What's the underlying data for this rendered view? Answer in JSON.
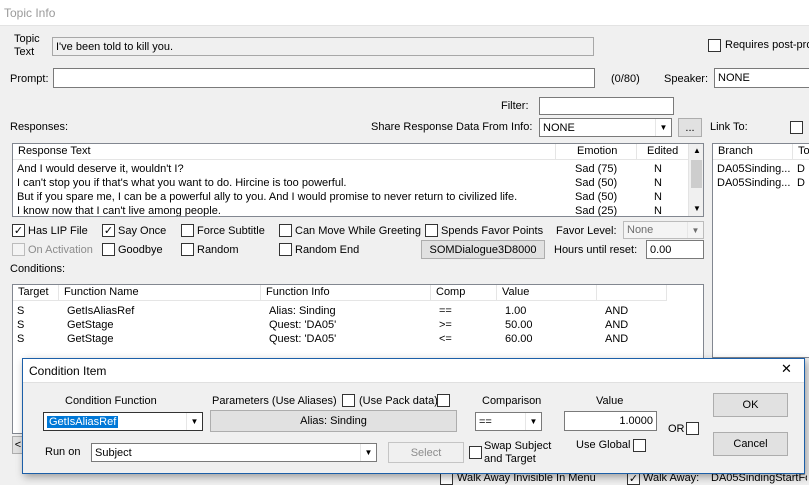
{
  "window": {
    "title": "Topic Info"
  },
  "topic": {
    "label": "Topic Text",
    "value": "I've been told to kill you."
  },
  "requires": {
    "label": "Requires post-pro"
  },
  "prompt": {
    "label": "Prompt:",
    "value": "",
    "counter": "(0/80)"
  },
  "speaker": {
    "label": "Speaker:",
    "value": "NONE"
  },
  "filter": {
    "label": "Filter:",
    "value": ""
  },
  "responses": {
    "label": "Responses:",
    "share_label": "Share Response Data From Info:",
    "share_value": "NONE",
    "ellipsis": "...",
    "columns": [
      "Response Text",
      "Emotion",
      "Edited"
    ],
    "rows": [
      {
        "text": "And I would deserve it, wouldn't I?",
        "emotion": "Sad (75)",
        "edited": "N"
      },
      {
        "text": "I can't stop you if that's what you want to do. Hircine is too powerful.",
        "emotion": "Sad (50)",
        "edited": "N"
      },
      {
        "text": "But if you spare me, I can be a powerful ally to you. And I would promise to never return to civilized life.",
        "emotion": "Sad (50)",
        "edited": "N"
      },
      {
        "text": "I know now that I can't live among people.",
        "emotion": "Sad (25)",
        "edited": "N"
      }
    ]
  },
  "link_to": {
    "label": "Link To:",
    "columns": [
      "Branch",
      "To"
    ],
    "rows": [
      {
        "branch": "DA05Sinding...",
        "to": "D"
      },
      {
        "branch": "DA05Sinding...",
        "to": "D"
      }
    ]
  },
  "flags": {
    "has_lip": {
      "label": "Has LIP File",
      "checked": true
    },
    "say_once": {
      "label": "Say Once",
      "checked": true
    },
    "force_subtitle": {
      "label": "Force Subtitle",
      "checked": false
    },
    "can_move": {
      "label": "Can Move While Greeting",
      "checked": false
    },
    "spends_favor": {
      "label": "Spends Favor Points",
      "checked": false
    },
    "on_activation": {
      "label": "On Activation",
      "checked": false
    },
    "goodbye": {
      "label": "Goodbye",
      "checked": false
    },
    "random": {
      "label": "Random",
      "checked": false
    },
    "random_end": {
      "label": "Random End",
      "checked": false
    }
  },
  "favor_level": {
    "label": "Favor Level:",
    "value": "None"
  },
  "dialogue_button": "SOMDialogue3D8000",
  "hours_reset": {
    "label": "Hours until reset:",
    "value": "0.00"
  },
  "conditions": {
    "label": "Conditions:",
    "columns": [
      "Target",
      "Function Name",
      "Function Info",
      "Comp",
      "Value",
      ""
    ],
    "rows": [
      {
        "target": "S",
        "function": "GetIsAliasRef",
        "info": "Alias: Sinding",
        "comp": "==",
        "value": "1.00",
        "op": "AND"
      },
      {
        "target": "S",
        "function": "GetStage",
        "info": "Quest: 'DA05'",
        "comp": ">=",
        "value": "50.00",
        "op": "AND"
      },
      {
        "target": "S",
        "function": "GetStage",
        "info": "Quest: 'DA05'",
        "comp": "<=",
        "value": "60.00",
        "op": "AND"
      }
    ]
  },
  "bottom": {
    "left_arrow": "<",
    "walk_invisible": "Walk Away Invisible In Menu",
    "walk_away": "Walk Away:",
    "walk_away_value": "DA05SindingStartFo"
  },
  "condition_item": {
    "title": "Condition Item",
    "close": "✕",
    "function_label": "Condition Function",
    "function_value": "GetIsAliasRef",
    "parameters_label": "Parameters  (Use Aliases)",
    "pack_label": "(Use Pack data)",
    "param_button": "Alias: Sinding",
    "comparison_label": "Comparison",
    "comparison_value": "==",
    "value_label": "Value",
    "value": "1.0000",
    "or_label": "OR",
    "ok": "OK",
    "cancel": "Cancel",
    "run_on_label": "Run on",
    "run_on_value": "Subject",
    "select": "Select",
    "swap_label": "Swap Subject and Target",
    "use_global_label": "Use Global"
  }
}
